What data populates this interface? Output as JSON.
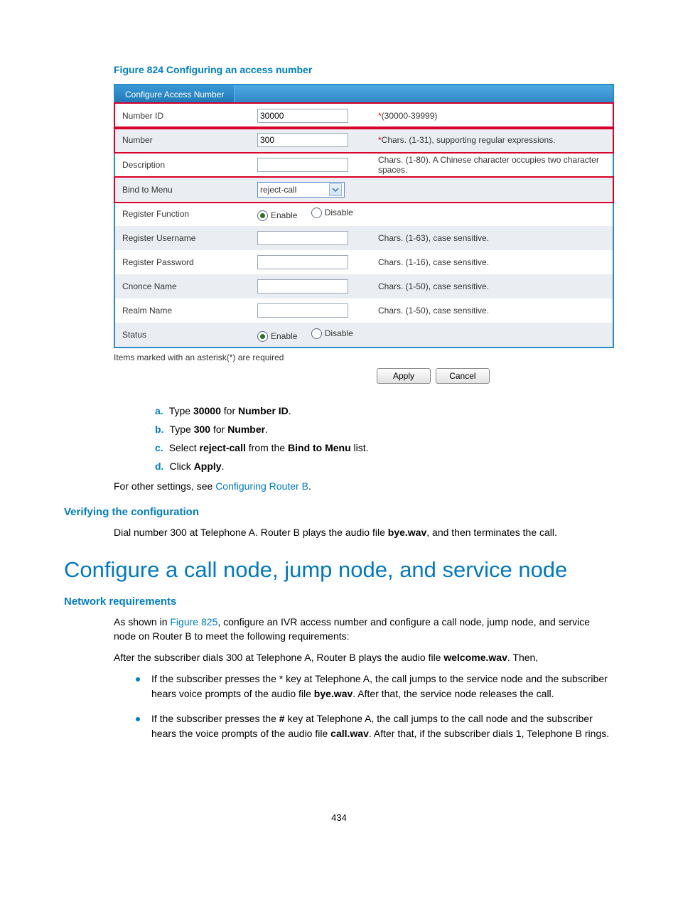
{
  "figure": {
    "caption": "Figure 824 Configuring an access number",
    "tab": "Configure Access Number",
    "rows": {
      "numberId": {
        "label": "Number ID",
        "value": "30000",
        "hint_prefix": "*",
        "hint": "(30000-39999)"
      },
      "number": {
        "label": "Number",
        "value": "300",
        "hint_prefix": "*",
        "hint": "Chars. (1-31), supporting regular expressions."
      },
      "description": {
        "label": "Description",
        "value": "",
        "hint": "Chars. (1-80). A Chinese character occupies two character spaces."
      },
      "bindMenu": {
        "label": "Bind to Menu",
        "value": "reject-call"
      },
      "regFunc": {
        "label": "Register Function",
        "enable": "Enable",
        "disable": "Disable"
      },
      "regUser": {
        "label": "Register Username",
        "value": "",
        "hint": "Chars. (1-63), case sensitive."
      },
      "regPassword": {
        "label": "Register Password",
        "value": "",
        "hint": "Chars. (1-16), case sensitive."
      },
      "cnonce": {
        "label": "Cnonce Name",
        "value": "",
        "hint": "Chars. (1-50), case sensitive."
      },
      "realm": {
        "label": "Realm Name",
        "value": "",
        "hint": "Chars. (1-50), case sensitive."
      },
      "status": {
        "label": "Status",
        "enable": "Enable",
        "disable": "Disable"
      }
    },
    "footnote": "Items marked with an asterisk(*) are required",
    "apply": "Apply",
    "cancel": "Cancel"
  },
  "steps": {
    "a": {
      "t1": "Type ",
      "b1": "30000",
      "t2": " for ",
      "b2": "Number ID",
      "t3": "."
    },
    "b": {
      "t1": "Type ",
      "b1": "300",
      "t2": " for ",
      "b2": "Number",
      "t3": "."
    },
    "c": {
      "t1": "Select ",
      "b1": "reject-call",
      "t2": " from the ",
      "b2": "Bind to Menu",
      "t3": " list."
    },
    "d": {
      "t1": "Click ",
      "b1": "Apply",
      "t3": "."
    }
  },
  "para1": {
    "t1": "For other settings, see ",
    "link": "Configuring Router B",
    "t2": "."
  },
  "h_verify": "Verifying the configuration",
  "para2": {
    "t1": "Dial number 300 at Telephone A. Router B plays the audio file ",
    "b1": "bye.wav",
    "t2": ", and then terminates the call."
  },
  "h1": "Configure a call node, jump node, and service node",
  "h_netreq": "Network requirements",
  "para3": {
    "t1": "As shown in ",
    "link": "Figure 825",
    "t2": ", configure an IVR access number and configure a call node, jump node, and service node on Router B to meet the following requirements:"
  },
  "para4": {
    "t1": "After the subscriber dials 300 at Telephone A, Router B plays the audio file ",
    "b1": "welcome.wav",
    "t2": ". Then,"
  },
  "bul1": {
    "t1": "If the subscriber presses the * key at Telephone A, the call jumps to the service node and the subscriber hears voice prompts of the audio file ",
    "b1": "bye.wav",
    "t2": ". After that, the service node releases the call."
  },
  "bul2": {
    "t1": "If the subscriber presses the ",
    "b0": "#",
    "t1b": " key at Telephone A, the call jumps to the call node and the subscriber hears the voice prompts of the audio file ",
    "b1": "call.wav",
    "t2": ". After that, if the subscriber dials 1, Telephone B rings."
  },
  "pagenum": "434"
}
